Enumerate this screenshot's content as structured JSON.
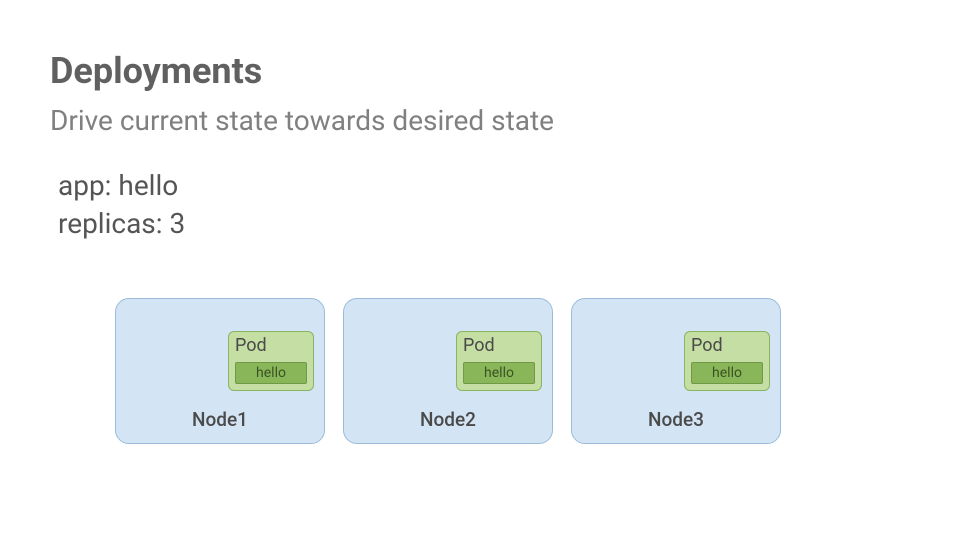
{
  "header": {
    "title": "Deployments",
    "subtitle": "Drive current state towards desired state"
  },
  "spec": {
    "line1": "app: hello",
    "line2": "replicas: 3"
  },
  "nodes": [
    {
      "label": "Node1",
      "pod_title": "Pod",
      "container": "hello"
    },
    {
      "label": "Node2",
      "pod_title": "Pod",
      "container": "hello"
    },
    {
      "label": "Node3",
      "pod_title": "Pod",
      "container": "hello"
    }
  ]
}
